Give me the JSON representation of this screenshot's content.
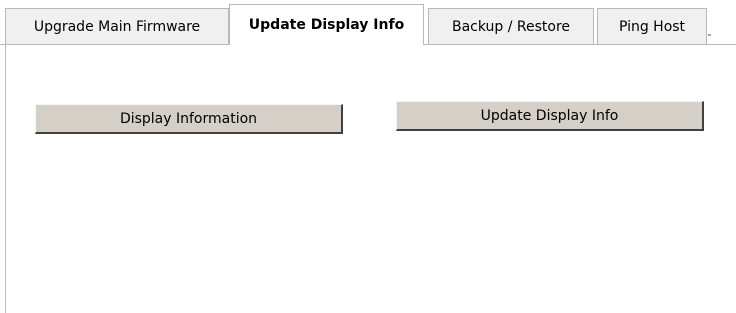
{
  "tabs": [
    {
      "label": "Upgrade Main Firmware",
      "active": false
    },
    {
      "label": "Update Display Info",
      "active": true
    },
    {
      "label": "Backup / Restore",
      "active": false
    },
    {
      "label": "Ping Host",
      "active": false
    }
  ],
  "tab_strip_marker": ".",
  "buttons": {
    "display_information": "Display Information",
    "update_display_info": "Update Display Info"
  }
}
